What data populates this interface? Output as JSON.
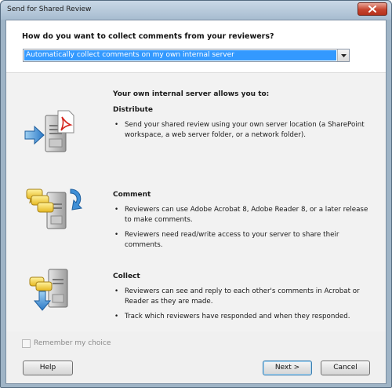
{
  "window": {
    "title": "Send for Shared Review"
  },
  "question": "How do you want to collect comments from your reviewers?",
  "dropdown": {
    "selected": "Automatically collect comments on my own internal server"
  },
  "intro": "Your own internal server allows you to:",
  "sections": [
    {
      "title": "Distribute",
      "icon": "distribute-icon",
      "bullets": [
        "Send your shared review using your own server location (a SharePoint workspace, a web server folder, or a network folder)."
      ]
    },
    {
      "title": "Comment",
      "icon": "comment-icon",
      "bullets": [
        "Reviewers can use Adobe Acrobat 8, Adobe Reader 8, or a later release to make comments.",
        "Reviewers need read/write access to your server to share their comments."
      ]
    },
    {
      "title": "Collect",
      "icon": "collect-icon",
      "bullets": [
        "Reviewers can see and reply to each other's comments in Acrobat or Reader as they are made.",
        "Track which reviewers have responded and when they responded."
      ]
    }
  ],
  "remember": {
    "label": "Remember my choice",
    "checked": false
  },
  "buttons": {
    "help": "Help",
    "next": "Next >",
    "cancel": "Cancel"
  },
  "bullet_glyph": "•",
  "colors": {
    "selection": "#3399ff",
    "close_button": "#c6452f",
    "default_button_border": "#3c7fb1"
  }
}
